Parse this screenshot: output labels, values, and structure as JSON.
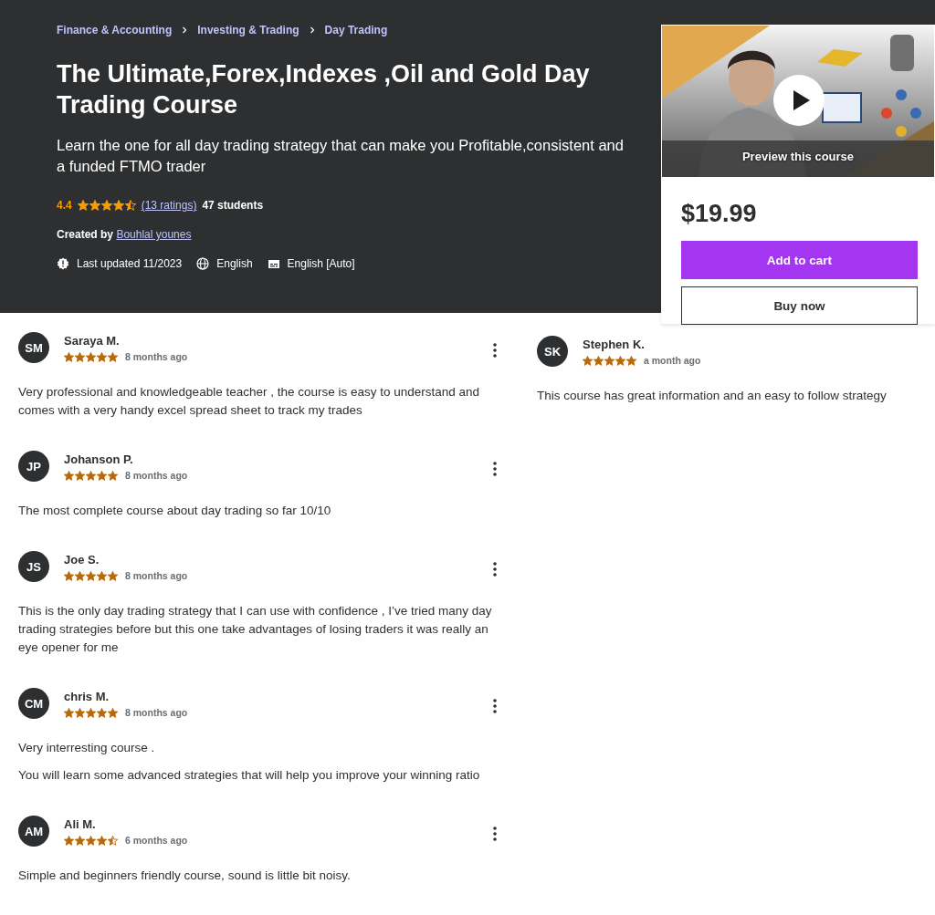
{
  "breadcrumbs": [
    "Finance & Accounting",
    "Investing & Trading",
    "Day Trading"
  ],
  "title": "The Ultimate,Forex,Indexes ,Oil and Gold Day Trading Course",
  "subtitle": "Learn the one for all day trading strategy that can make you Profitable,consistent and a funded FTMO trader",
  "rating": {
    "value": "4.4",
    "stars": 4.5,
    "count": "(13 ratings)",
    "students": "47 students"
  },
  "created_by": {
    "label": "Created by",
    "author": "Bouhlal younes"
  },
  "meta": [
    {
      "kind": "updated",
      "text": "Last updated 11/2023"
    },
    {
      "kind": "language",
      "text": "English"
    },
    {
      "kind": "captions",
      "text": "English [Auto]"
    }
  ],
  "purchase": {
    "preview": {
      "kind": "picture",
      "label": "Preview this course"
    },
    "price": "$19.99",
    "buttons": [
      {
        "kind": "primary",
        "label": "Add to cart"
      },
      {
        "kind": "secondary",
        "label": "Buy now"
      }
    ]
  },
  "reviews_left": [
    {
      "initials": "SM",
      "name": "Saraya M.",
      "stars": 5,
      "time": "8 months ago",
      "paragraphs": [
        "Very professional and knowledgeable teacher , the course is easy to understand and comes with a very handy excel spread sheet to track my trades"
      ]
    },
    {
      "initials": "JP",
      "name": "Johanson P.",
      "stars": 5,
      "time": "8 months ago",
      "paragraphs": [
        "The most complete course about day trading so far 10/10"
      ]
    },
    {
      "initials": "JS",
      "name": "Joe S.",
      "stars": 5,
      "time": "8 months ago",
      "paragraphs": [
        "This is the only day trading strategy that I can use with confidence , I’ve tried many day trading strategies before but this one take advantages of losing traders it was really an eye opener for me"
      ]
    },
    {
      "initials": "CM",
      "name": "chris M.",
      "stars": 5,
      "time": "8 months ago",
      "paragraphs": [
        "Very interresting course .",
        "You will learn some advanced strategies that will help you improve your winning ratio"
      ]
    },
    {
      "initials": "AM",
      "name": "Ali M.",
      "stars": 4.5,
      "time": "6 months ago",
      "paragraphs": [
        "Simple and beginners friendly course, sound is little bit noisy."
      ]
    }
  ],
  "reviews_right": [
    {
      "initials": "SK",
      "name": "Stephen K.",
      "stars": 5,
      "time": "a month ago",
      "paragraphs": [
        "This course has great information and an easy to follow strategy"
      ]
    }
  ]
}
